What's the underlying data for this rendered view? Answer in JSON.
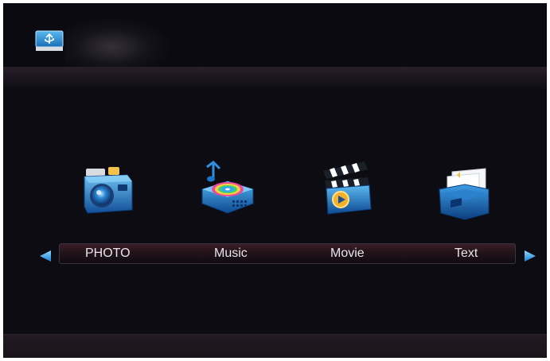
{
  "header": {
    "source_icon": "usb-icon",
    "source_label": ""
  },
  "categories": [
    {
      "label": "PHOTO",
      "icon": "camera-icon"
    },
    {
      "label": "Music",
      "icon": "music-player-icon"
    },
    {
      "label": "Movie",
      "icon": "clapperboard-icon"
    },
    {
      "label": "Text",
      "icon": "text-folder-icon"
    }
  ],
  "navigation": {
    "left_icon": "arrow-left-icon",
    "right_icon": "arrow-right-icon"
  },
  "colors": {
    "accent": "#1e8fe0",
    "background": "#0d0c12",
    "label_text": "#e7e5ea"
  }
}
